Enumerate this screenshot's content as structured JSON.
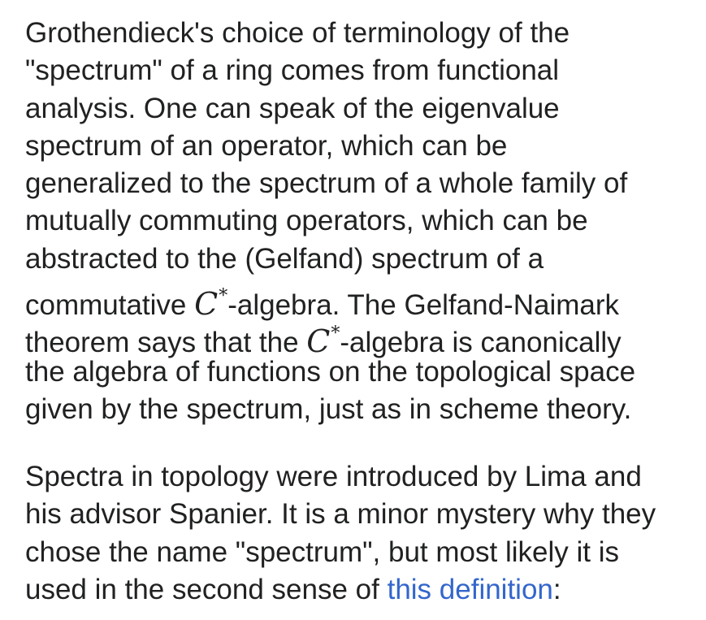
{
  "colors": {
    "text": "#202122",
    "link": "#3366cc",
    "background": "#ffffff"
  },
  "paragraph_1": {
    "line_1": "Grothendieck's choice of terminology of the",
    "line_2": "\"spectrum\" of a ring comes from functional",
    "line_3": "analysis. One can speak of the eigenvalue",
    "line_4": "spectrum of an operator, which can be",
    "line_5": "generalized to the spectrum of a whole family of",
    "line_6": "mutually commuting operators, which can be",
    "line_7": "abstracted to the (Gelfand) spectrum of a",
    "line_8_before": "commutative ",
    "math_c": "C",
    "math_star": "*",
    "line_8_after": "-algebra. The Gelfand-Naimark",
    "line_9_before": "theorem says that the ",
    "line_9_after": "-algebra is canonically",
    "line_10": "the algebra of functions on the topological space",
    "line_11": "given by the spectrum, just as in scheme theory."
  },
  "paragraph_2": {
    "line_1": "Spectra in topology were introduced by Lima and",
    "line_2": "his advisor Spanier. It is a minor mystery why they",
    "line_3": "chose the name \"spectrum\", but most likely it is",
    "line_4_before": "used in the second sense of ",
    "link_text": "this definition",
    "line_4_after": ":"
  }
}
